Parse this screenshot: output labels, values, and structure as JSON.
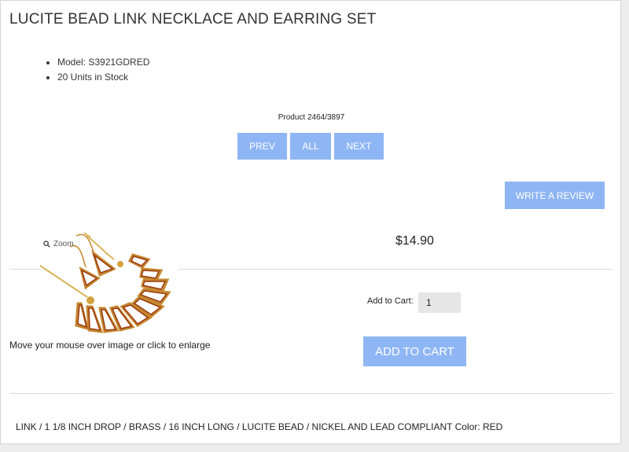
{
  "product": {
    "title": "LUCITE BEAD LINK NECKLACE AND EARRING SET",
    "info": [
      "Model: S3921GDRED",
      "20 Units in Stock"
    ],
    "counter": "Product 2464/3897",
    "price": "$14.90",
    "description": "LINK / 1 1/8 INCH DROP / BRASS / 16 INCH LONG / LUCITE BEAD / NICKEL AND LEAD COMPLIANT Color: RED"
  },
  "nav": {
    "prev": "PREV",
    "all": "ALL",
    "next": "NEXT"
  },
  "review": {
    "label": "WRITE A REVIEW"
  },
  "image": {
    "zoom_label": "Zoom",
    "hint": "Move your mouse over image or click to enlarge"
  },
  "cart": {
    "label": "Add to Cart:",
    "quantity": "1",
    "button": "ADD TO CART"
  },
  "colors": {
    "button": "#8fb6f4",
    "frame": "#c4862f",
    "enamel": "#9c3a0e"
  }
}
